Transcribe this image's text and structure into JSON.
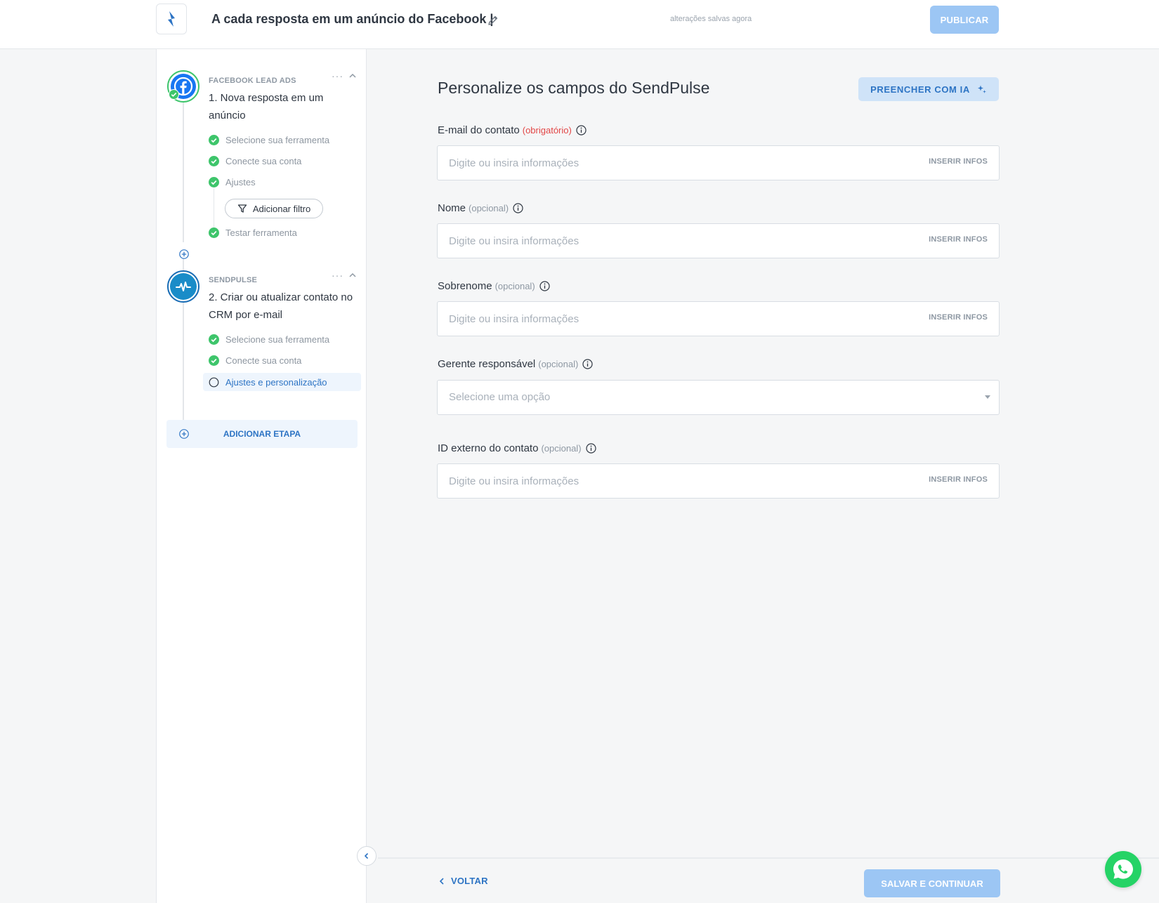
{
  "header": {
    "flow_title": "A cada resposta em um anúncio do Facebook |",
    "saved_status": "alterações salvas agora",
    "publish_label": "PUBLICAR"
  },
  "sidebar": {
    "steps": [
      {
        "app": "FACEBOOK LEAD ADS",
        "title": "1. Nova resposta em um anúncio",
        "more": "···",
        "substeps": [
          {
            "label": "Selecione sua ferramenta",
            "status": "done"
          },
          {
            "label": "Conecte sua conta",
            "status": "done"
          },
          {
            "label": "Ajustes",
            "status": "done"
          },
          {
            "label": "Testar ferramenta",
            "status": "done"
          }
        ],
        "filter_label": "Adicionar filtro"
      },
      {
        "app": "SENDPULSE",
        "title": "2. Criar ou atualizar contato no CRM por e-mail",
        "more": "···",
        "substeps": [
          {
            "label": "Selecione sua ferramenta",
            "status": "done"
          },
          {
            "label": "Conecte sua conta",
            "status": "done"
          },
          {
            "label": "Ajustes e personalização",
            "status": "active"
          }
        ]
      }
    ],
    "add_step_label": "ADICIONAR ETAPA"
  },
  "main": {
    "title": "Personalize os campos do SendPulse",
    "ai_button": "PREENCHER COM IA",
    "fields": [
      {
        "label": "E-mail do contato",
        "tag": "(obrigatório)",
        "placeholder": "Digite ou insira informações",
        "action": "INSERIR INFOS"
      },
      {
        "label": "Nome",
        "tag": "(opcional)",
        "placeholder": "Digite ou insira informações",
        "action": "INSERIR INFOS"
      },
      {
        "label": "Sobrenome",
        "tag": "(opcional)",
        "placeholder": "Digite ou insira informações",
        "action": "INSERIR INFOS"
      },
      {
        "label": "Gerente responsável",
        "tag": "(opcional)",
        "placeholder": "Selecione uma opção"
      },
      {
        "label": "ID externo do contato",
        "tag": "(opcional)",
        "placeholder": "Digite ou insira informações",
        "action": "INSERIR INFOS"
      }
    ]
  },
  "footer": {
    "back_label": "VOLTAR",
    "save_label": "SALVAR E CONTINUAR"
  },
  "colors": {
    "accent": "#2d74c4",
    "button_disabled": "#9cc6f4",
    "success": "#3ec56b",
    "required": "#e24646",
    "facebook": "#1877f2",
    "sendpulse": "#1a8cc8",
    "whatsapp": "#25d366"
  },
  "icons": [
    "logo-icon",
    "edit-icon",
    "sparkle-icon",
    "info-icon",
    "check-icon",
    "filter-icon",
    "plus-icon",
    "chevron-up-icon",
    "chevron-left-icon",
    "facebook-icon",
    "sendpulse-icon",
    "whatsapp-icon"
  ]
}
